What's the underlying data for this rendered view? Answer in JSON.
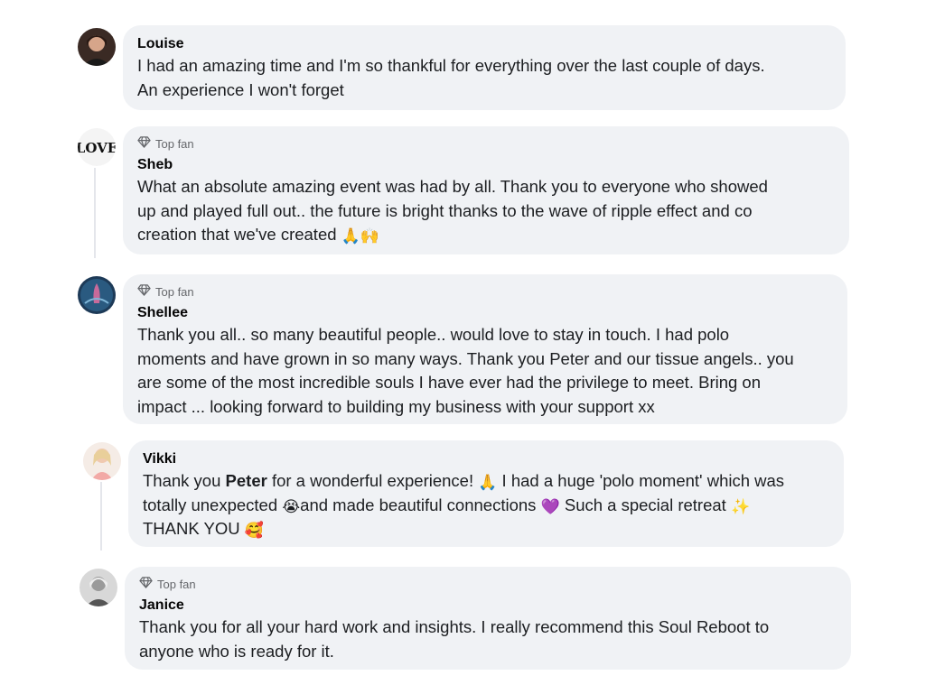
{
  "comments": [
    {
      "author": "Louise",
      "badge": "",
      "text": "I had an amazing time and I'm so thankful for everything over the last couple of days.\nAn experience I won't forget"
    },
    {
      "author": "Sheb",
      "badge": "Top fan",
      "text": "What an absolute amazing event was had by all. Thank you to everyone who showed\nup and played full out.. the future is bright thanks to the wave of ripple effect and co\ncreation that we've created ",
      "emoji": "🙏🙌",
      "avatar_text": "LOVE"
    },
    {
      "author": "Shellee",
      "badge": "Top fan",
      "text": "Thank you all.. so many beautiful people.. would love to stay in touch. I had polo\nmoments and have grown in so many ways. Thank you Peter and our tissue angels.. you\nare some of the most incredible souls I have ever had the privilege to meet. Bring on\nimpact ... looking forward to building my business with your support xx"
    },
    {
      "author": "Vikki",
      "badge": "",
      "text_1": "Thank you ",
      "text_bold": "Peter",
      "text_2": " for a wonderful experience! ",
      "emoji_1": "🙏",
      "text_3": " I had a huge 'polo moment' which was\ntotally unexpected ",
      "emoji_2": "😭",
      "text_4": "and made beautiful connections ",
      "emoji_3": "💜",
      "text_5": " Such a special retreat ",
      "emoji_4": "✨",
      "text_6": "\nTHANK YOU ",
      "emoji_5": "🥰"
    },
    {
      "author": "Janice",
      "badge": "Top fan",
      "text": "Thank you for all your hard work and insights. I really recommend this Soul Reboot to\nanyone who is ready for it."
    }
  ],
  "colors": {
    "bubble": "#f0f2f5",
    "badge_text": "#65676b",
    "thread_line": "#e4e6eb"
  },
  "icons": {
    "badge": "diamond-icon"
  }
}
